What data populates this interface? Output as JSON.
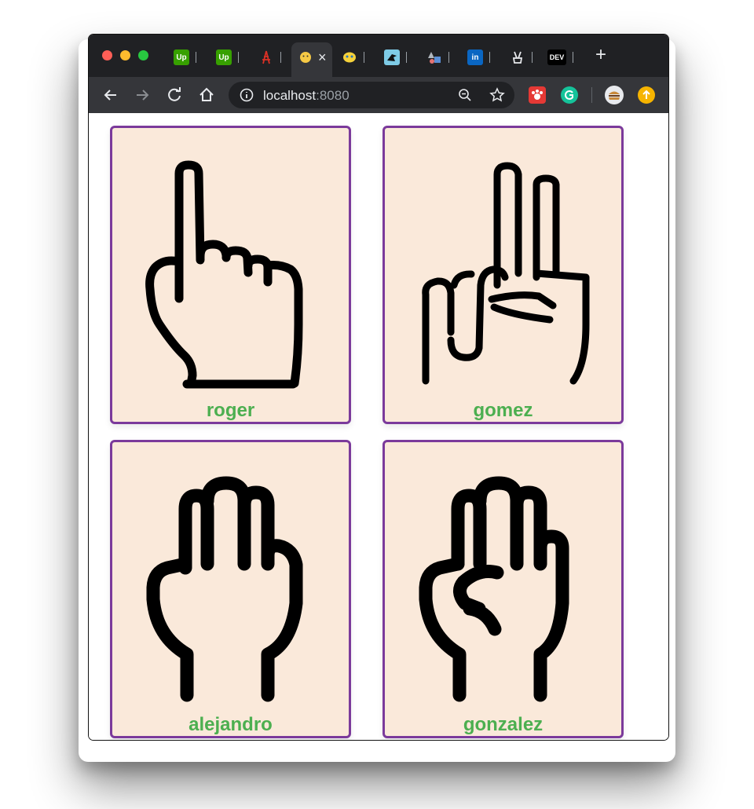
{
  "browser": {
    "tabs": [
      {
        "icon": "upwork-icon",
        "text": "Up"
      },
      {
        "icon": "upwork-icon",
        "text": "Up"
      },
      {
        "icon": "tower-icon",
        "text": ""
      },
      {
        "icon": "emoji-face-icon",
        "text": "",
        "active": true
      },
      {
        "icon": "pokemon-icon",
        "text": ""
      },
      {
        "icon": "bird-icon",
        "text": ""
      },
      {
        "icon": "shapes-icon",
        "text": ""
      },
      {
        "icon": "linkedin-icon",
        "text": "in"
      },
      {
        "icon": "peace-hand-icon",
        "text": ""
      },
      {
        "icon": "dev-icon",
        "text": "DEV"
      }
    ],
    "close_label": "×",
    "new_tab_label": "+",
    "url_host": "localhost",
    "url_port": ":8080"
  },
  "cards": [
    {
      "name": "roger",
      "icon": "one-finger-hand-icon"
    },
    {
      "name": "gomez",
      "icon": "two-finger-hand-icon"
    },
    {
      "name": "alejandro",
      "icon": "three-finger-hand-icon"
    },
    {
      "name": "gonzalez",
      "icon": "four-finger-hand-icon"
    }
  ],
  "colors": {
    "card_bg": "#fae9da",
    "card_border": "#7b3a9b",
    "label_green": "#4caf50",
    "chrome_dark": "#202124"
  }
}
